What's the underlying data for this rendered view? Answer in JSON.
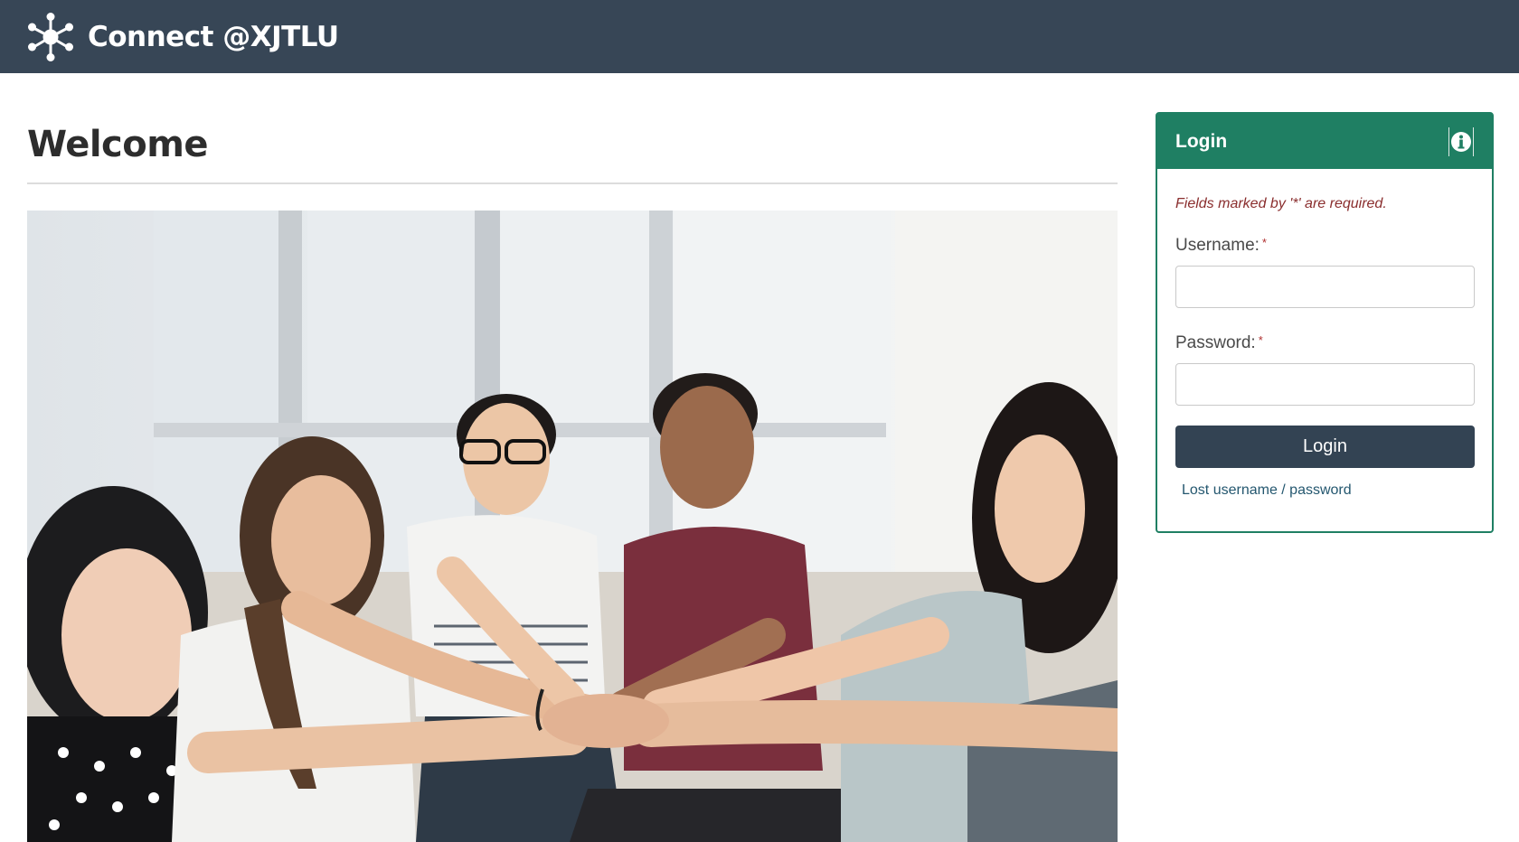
{
  "header": {
    "brand_name": "Connect @XJTLU",
    "logo_icon": "network-hub-icon",
    "background_color": "#374656"
  },
  "main": {
    "title": "Welcome",
    "hero_image": "group-of-students-hands-together-photo"
  },
  "login": {
    "title": "Login",
    "info_icon": "info-icon",
    "required_note": "Fields marked by '*' are required.",
    "username_label": "Username:",
    "password_label": "Password:",
    "required_mark": "*",
    "username_value": "",
    "password_value": "",
    "submit_label": "Login",
    "lost_link": "Lost username / password",
    "accent_color": "#1f7f63",
    "button_color": "#334353"
  }
}
